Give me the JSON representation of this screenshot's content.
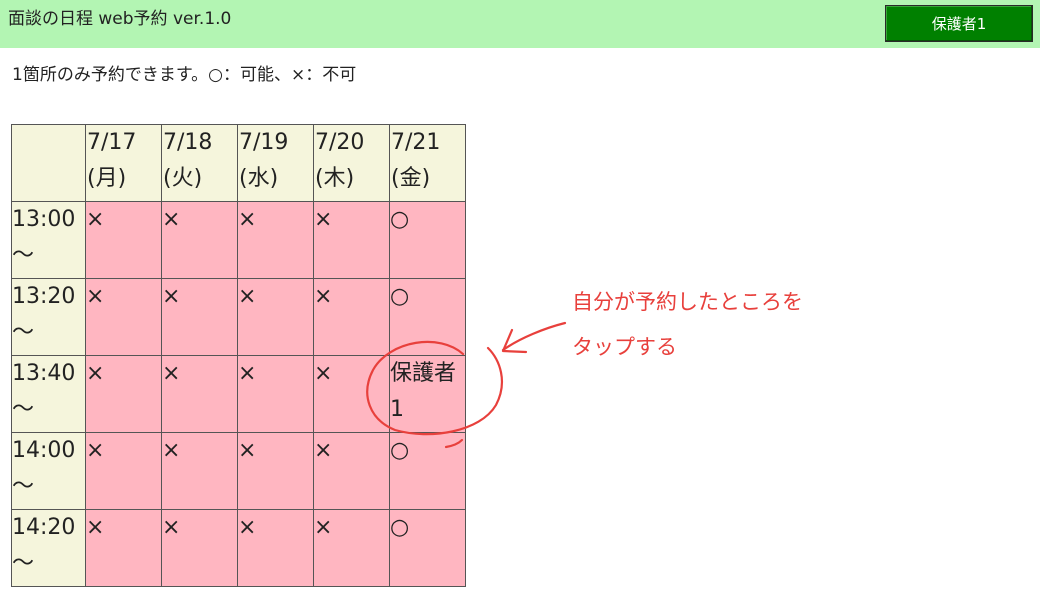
{
  "header": {
    "title": "面談の日程 web予約 ver.1.0",
    "user_button": "保護者1",
    "bg_color": "#b3f5b3",
    "button_color": "#008000"
  },
  "notice": "1箇所のみ予約できます。○：可能、×：不可",
  "schedule": {
    "dates": [
      {
        "date": "7/17",
        "day": "(月)"
      },
      {
        "date": "7/18",
        "day": "(火)"
      },
      {
        "date": "7/19",
        "day": "(水)"
      },
      {
        "date": "7/20",
        "day": "(木)"
      },
      {
        "date": "7/21",
        "day": "(金)"
      }
    ],
    "rows": [
      {
        "time": "13:00",
        "tilde": "～",
        "cells": [
          "×",
          "×",
          "×",
          "×",
          "○"
        ]
      },
      {
        "time": "13:20",
        "tilde": "～",
        "cells": [
          "×",
          "×",
          "×",
          "×",
          "○"
        ]
      },
      {
        "time": "13:40",
        "tilde": "～",
        "cells": [
          "×",
          "×",
          "×",
          "×",
          "保護者1"
        ]
      },
      {
        "time": "14:00",
        "tilde": "～",
        "cells": [
          "×",
          "×",
          "×",
          "×",
          "○"
        ]
      },
      {
        "time": "14:20",
        "tilde": "～",
        "cells": [
          "×",
          "×",
          "×",
          "×",
          "○"
        ]
      }
    ],
    "header_bg": "#f5f5dc",
    "slot_bg": "#ffb6c1"
  },
  "annotation": {
    "line1": "自分が予約したところを",
    "line2": "タップする",
    "color": "#e8403c"
  }
}
